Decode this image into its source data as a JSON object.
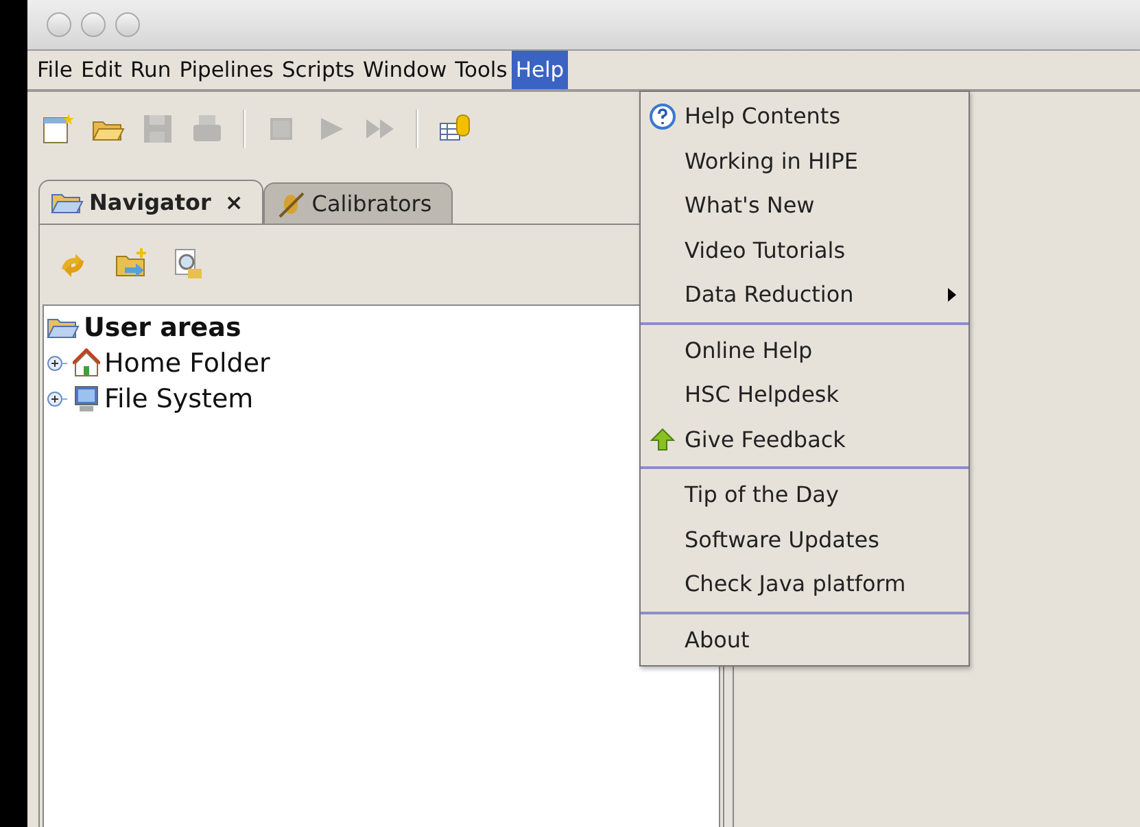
{
  "menubar": [
    {
      "label": "File",
      "selected": false
    },
    {
      "label": "Edit",
      "selected": false
    },
    {
      "label": "Run",
      "selected": false
    },
    {
      "label": "Pipelines",
      "selected": false
    },
    {
      "label": "Scripts",
      "selected": false
    },
    {
      "label": "Window",
      "selected": false
    },
    {
      "label": "Tools",
      "selected": false
    },
    {
      "label": "Help",
      "selected": true
    }
  ],
  "toolbar": [
    {
      "kind": "button",
      "disabled": false
    },
    {
      "kind": "button",
      "disabled": false
    },
    {
      "kind": "button",
      "disabled": true
    },
    {
      "kind": "button",
      "disabled": true
    },
    {
      "kind": "separator"
    },
    {
      "kind": "button",
      "disabled": true
    },
    {
      "kind": "button",
      "disabled": true
    },
    {
      "kind": "button",
      "disabled": true
    },
    {
      "kind": "separator"
    },
    {
      "kind": "button",
      "disabled": false
    }
  ],
  "tabs": [
    {
      "label": "Navigator",
      "selected": true,
      "close": "×"
    },
    {
      "label": "Calibrators",
      "selected": false
    }
  ],
  "tree": [
    {
      "label": "User areas",
      "expanded": true,
      "children": [
        {
          "label": "Home Folder",
          "expanded": false
        },
        {
          "label": "File System",
          "expanded": false
        }
      ]
    }
  ],
  "help_menu": [
    {
      "kind": "item",
      "label": "Help Contents",
      "submenu": false
    },
    {
      "kind": "item",
      "label": "Working in HIPE",
      "submenu": false
    },
    {
      "kind": "item",
      "label": "What's New",
      "submenu": false
    },
    {
      "kind": "item",
      "label": "Video Tutorials",
      "submenu": false
    },
    {
      "kind": "item",
      "label": "Data Reduction",
      "submenu": true
    },
    {
      "kind": "separator"
    },
    {
      "kind": "item",
      "label": "Online Help",
      "submenu": false
    },
    {
      "kind": "item",
      "label": "HSC Helpdesk",
      "submenu": false
    },
    {
      "kind": "item",
      "label": "Give Feedback",
      "submenu": false
    },
    {
      "kind": "separator"
    },
    {
      "kind": "item",
      "label": "Tip of the Day",
      "submenu": false
    },
    {
      "kind": "item",
      "label": "Software Updates",
      "submenu": false
    },
    {
      "kind": "item",
      "label": "Check Java platform",
      "submenu": false
    },
    {
      "kind": "separator"
    },
    {
      "kind": "item",
      "label": "About",
      "submenu": false
    }
  ]
}
